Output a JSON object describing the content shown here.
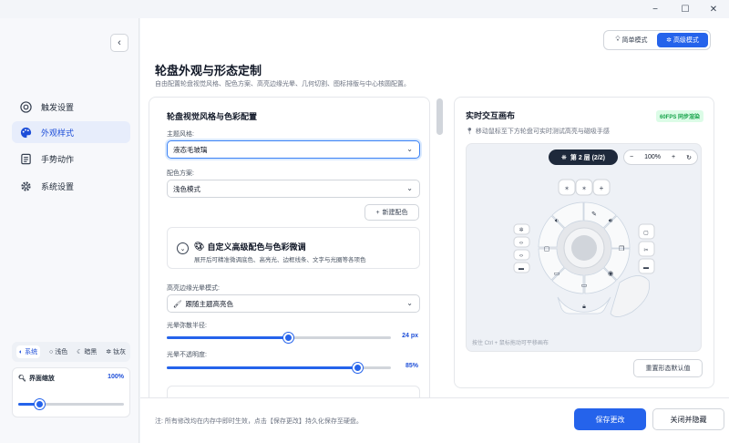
{
  "window": {
    "minimize": "−",
    "maximize": "☐",
    "close": "✕"
  },
  "sidebar": {
    "collapse_icon": "chevron-left-icon",
    "items": [
      {
        "label": "触发设置",
        "icon": "target-icon"
      },
      {
        "label": "外观样式",
        "icon": "palette-icon",
        "active": true
      },
      {
        "label": "手势动作",
        "icon": "list-icon"
      },
      {
        "label": "系统设置",
        "icon": "gear-icon"
      }
    ],
    "theme_options": [
      "系统",
      "浅色",
      "暗黑",
      "钛灰"
    ],
    "zoom": {
      "label": "界面缩放",
      "value": "100%",
      "level": 0.2
    }
  },
  "header": {
    "mode_simple": "简单模式",
    "mode_advanced": "高级模式",
    "title": "轮盘外观与形态定制",
    "subtitle": "自由配置轮盘视觉风格、配色方案、高亮边缘光晕、几何切割、图标排版与中心核圆配置。"
  },
  "style_panel": {
    "title": "轮盘视觉风格与色彩配置",
    "theme_label": "主题风格:",
    "theme_value": "液态毛玻璃",
    "color_label": "配色方案:",
    "color_value": "浅色模式",
    "new_color": "新建配色",
    "advanced": {
      "title": "自定义高级配色与色彩微调",
      "subtitle": "展开后可精准微调底色、高亮光、边框线条、文字与光圈等各项色"
    },
    "glow_mode_label": "高亮边缘光晕模式:",
    "glow_mode_value": "跟随主题高亮色",
    "glow_radius_label": "光晕弥散半径:",
    "glow_radius_value": "24 px",
    "glow_radius_level": 0.54,
    "glow_opacity_label": "光晕不透明度:",
    "glow_opacity_value": "85%",
    "glow_opacity_level": 0.85
  },
  "preview": {
    "title": "实时交互画布",
    "fps": "60FPS 同步渲染",
    "subtitle": "移动鼠标至下方轮盘可实时测试高亮与磁吸手感",
    "layer": "第 2 层 (2/2)",
    "zoom_minus": "−",
    "zoom_value": "100%",
    "zoom_plus": "+",
    "hint": "按住 Ctrl + 鼠标拖动可平移画布",
    "reset": "重置形态默认值"
  },
  "footer": {
    "note": "注: 所有修改均在内存中即时生效，点击【保存更改】持久化保存至硬盘。",
    "save": "保存更改",
    "close": "关闭并隐藏"
  },
  "colors": {
    "accent": "#2563eb",
    "sidebar_active_bg": "#e7edfb",
    "fps_green": "#16a34a"
  }
}
